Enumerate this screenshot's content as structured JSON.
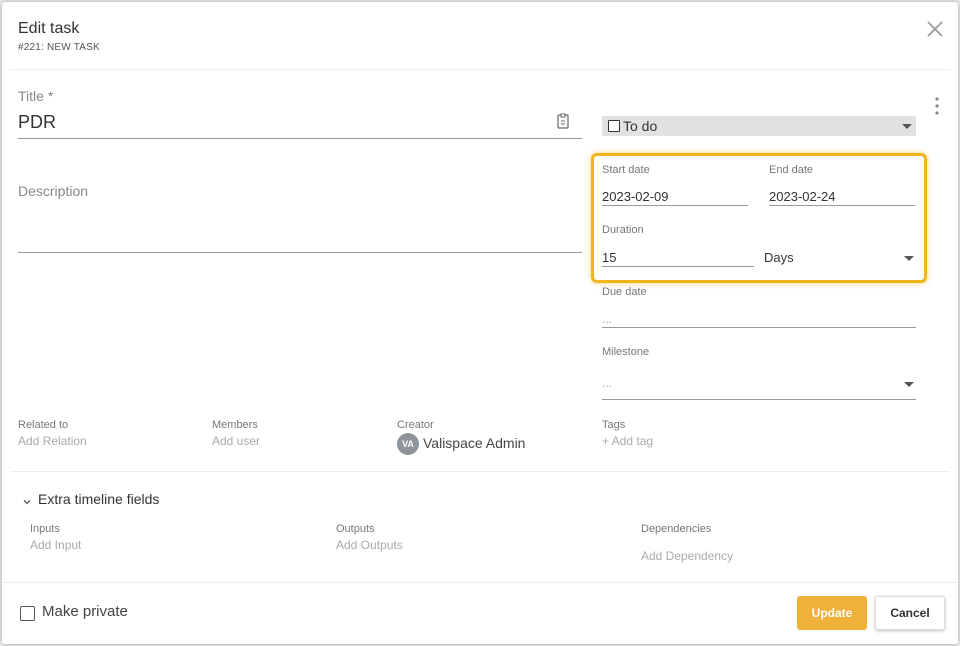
{
  "header": {
    "title": "Edit task",
    "subtitle": "#221: NEW TASK"
  },
  "form": {
    "title_label": "Title *",
    "title_value": "PDR",
    "description_label": "Description",
    "status": {
      "value": "To do"
    },
    "start_date": {
      "label": "Start date",
      "value": "2023-02-09"
    },
    "end_date": {
      "label": "End date",
      "value": "2023-02-24"
    },
    "duration": {
      "label": "Duration",
      "value": "15",
      "unit": "Days"
    },
    "due_date": {
      "label": "Due date",
      "value": "..."
    },
    "milestone": {
      "label": "Milestone",
      "value": "..."
    },
    "related_to": {
      "label": "Related to",
      "action": "Add Relation"
    },
    "members": {
      "label": "Members",
      "action": "Add user"
    },
    "creator": {
      "label": "Creator",
      "initials": "VA",
      "name": "Valispace Admin"
    },
    "tags": {
      "label": "Tags",
      "action": "+ Add tag"
    }
  },
  "extra": {
    "toggle_label": "Extra timeline fields",
    "inputs": {
      "label": "Inputs",
      "action": "Add Input"
    },
    "outputs": {
      "label": "Outputs",
      "action": "Add Outputs"
    },
    "dependencies": {
      "label": "Dependencies",
      "action": "Add Dependency"
    }
  },
  "footer": {
    "private_label": "Make private",
    "update_label": "Update",
    "cancel_label": "Cancel"
  },
  "colors": {
    "accent": "#f0b13a",
    "highlight": "#f0b41e"
  },
  "icons": [
    "close-icon",
    "clipboard-icon",
    "kebab-menu-icon",
    "checkbox-icon",
    "chevron-down-icon"
  ]
}
